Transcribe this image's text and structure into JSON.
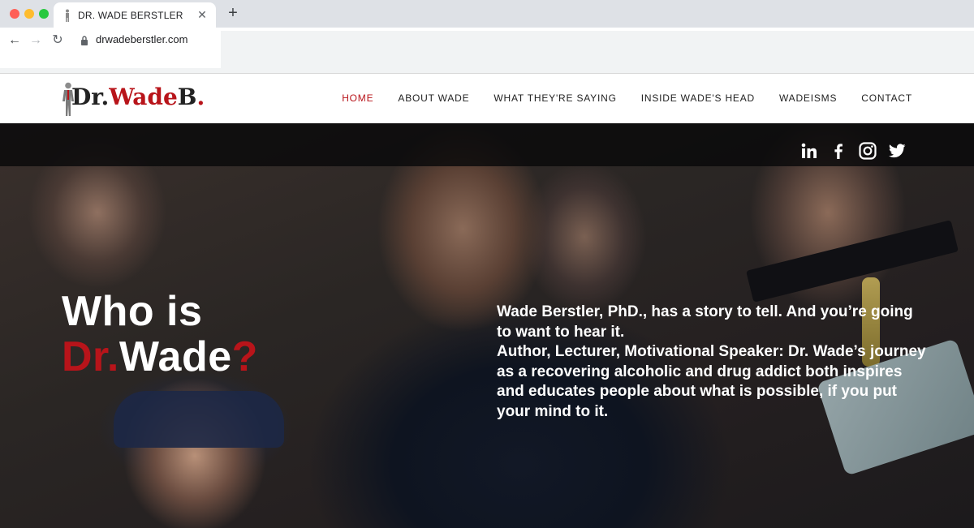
{
  "browser": {
    "tab_title": "DR. WADE BERSTLER",
    "tab_close": "✕",
    "new_tab": "+",
    "url": "drwadeberstler.com",
    "back": "←",
    "forward": "→",
    "reload": "↻"
  },
  "header": {
    "logo": {
      "part1": "Dr.",
      "part2": "Wade",
      "part3": "B",
      "part4": "."
    },
    "nav": [
      {
        "label": "HOME",
        "active": true
      },
      {
        "label": "ABOUT WADE",
        "active": false
      },
      {
        "label": "WHAT THEY'RE SAYING",
        "active": false
      },
      {
        "label": "INSIDE WADE'S HEAD",
        "active": false
      },
      {
        "label": "WADEISMS",
        "active": false
      },
      {
        "label": "CONTACT",
        "active": false
      }
    ]
  },
  "hero": {
    "title_line1": "Who is",
    "title_dr": "Dr.",
    "title_wade": "Wade",
    "title_q": "?",
    "paragraph1": "Wade Berstler, PhD., has a story to tell. And you’re going to want to hear it.",
    "paragraph2": "Author, Lecturer, Motivational Speaker: Dr. Wade’s journey as a recovering alcoholic and drug addict both inspires and educates people about what is possible, if you put your mind to it.",
    "social": [
      "linkedin-icon",
      "facebook-icon",
      "instagram-icon",
      "twitter-icon"
    ]
  },
  "colors": {
    "accent": "#b8141a",
    "text_dark": "#222222"
  }
}
